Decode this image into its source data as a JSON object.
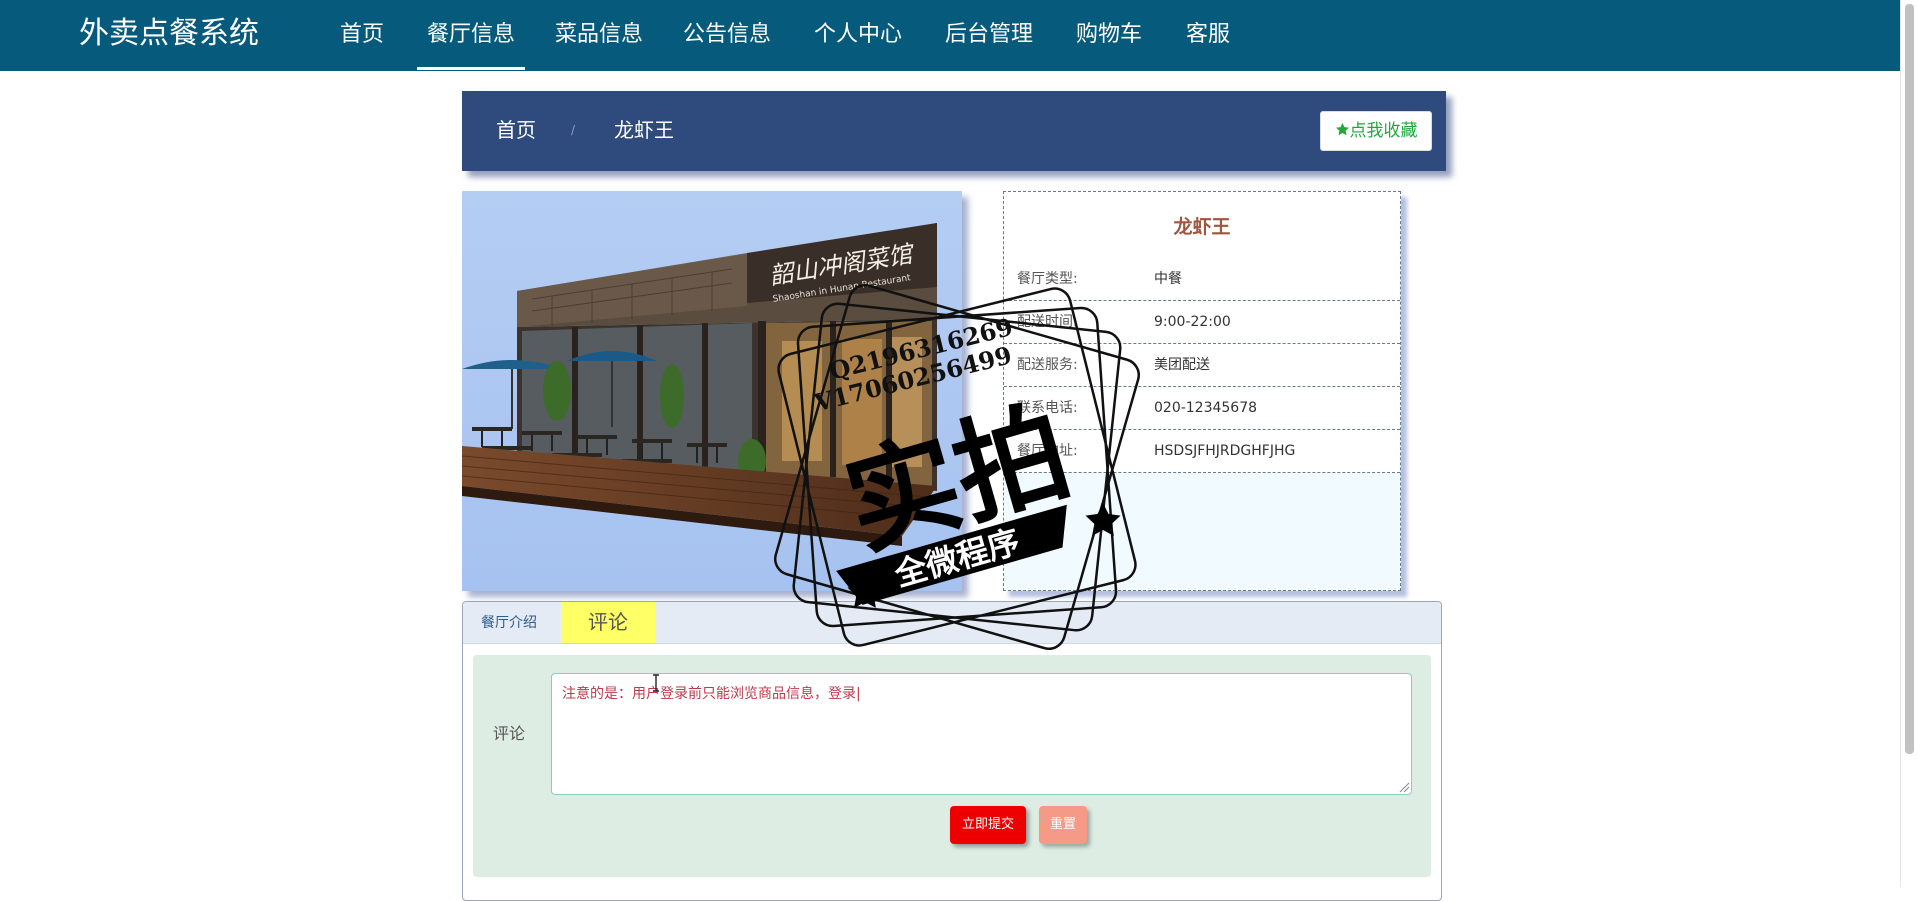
{
  "brand": "外卖点餐系统",
  "nav": {
    "items": [
      {
        "label": "首页"
      },
      {
        "label": "餐厅信息"
      },
      {
        "label": "菜品信息"
      },
      {
        "label": "公告信息"
      },
      {
        "label": "个人中心"
      },
      {
        "label": "后台管理"
      },
      {
        "label": "购物车"
      },
      {
        "label": "客服"
      }
    ],
    "active": "餐厅信息"
  },
  "breadcrumb": {
    "home": "首页",
    "separator": "/",
    "current": "龙虾王"
  },
  "favorite": {
    "icon": "star-icon",
    "label": "点我收藏"
  },
  "photo": {
    "sign_text": "韶山冲阁菜馆",
    "sign_sub": "Shaoshan in Hunan Restaurant"
  },
  "restaurant": {
    "name": "龙虾王",
    "fields": [
      {
        "label": "餐厅类型:",
        "value": "中餐"
      },
      {
        "label": "配送时间:",
        "value": "9:00-22:00"
      },
      {
        "label": "配送服务:",
        "value": "美团配送"
      },
      {
        "label": "联系电话:",
        "value": "020-12345678"
      },
      {
        "label": "餐厅地址:",
        "value": "HSDSJFHJRDGHFJHG"
      }
    ]
  },
  "tabs": {
    "intro": "餐厅介绍",
    "comment": "评论",
    "active": "评论"
  },
  "comment_form": {
    "label": "评论",
    "placeholder": "注意的是：用户登录前只能浏览商品信息，登录|",
    "submit": "立即提交",
    "reset": "重置"
  },
  "watermark": {
    "line1": "Q2196316269",
    "line2": "V17060256499",
    "main": "实拍",
    "banner": "全微程序"
  },
  "colors": {
    "nav_bg": "#065a7b",
    "breadcrumb_bg": "#2f4b7e",
    "favorite_text": "#22a83a",
    "restaurant_name": "#a0563e",
    "comment_tab": "#ffff66",
    "comment_box": "#ddede4",
    "submit": "#ee0000",
    "reset": "#f49a87",
    "placeholder": "#c0394b"
  }
}
